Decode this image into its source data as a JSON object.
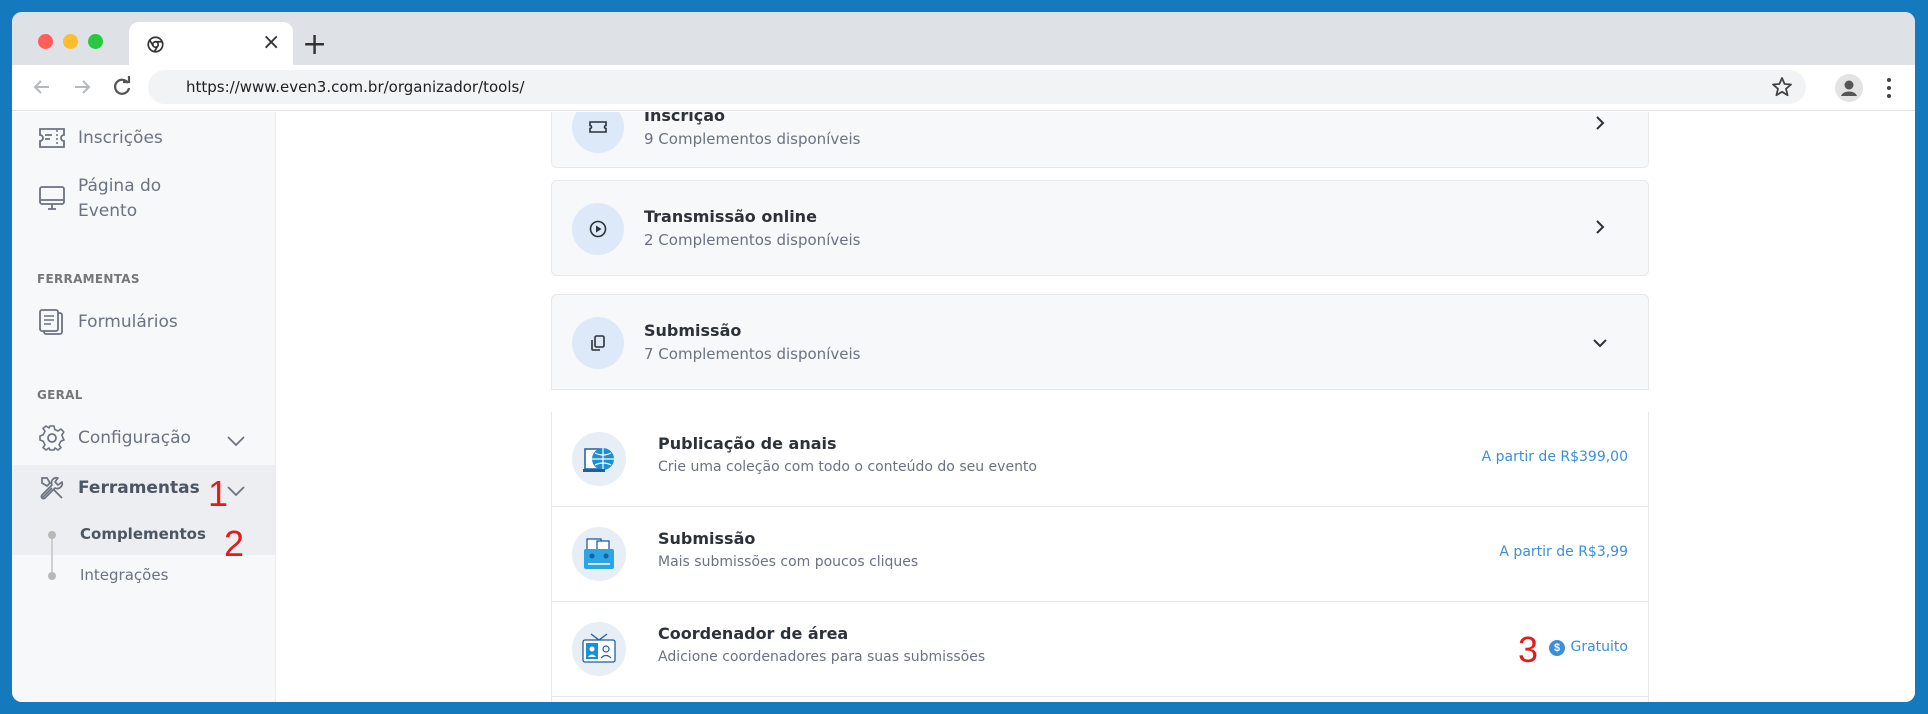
{
  "browser": {
    "url": "https://www.even3.com.br/organizador/tools/",
    "tab_close": "×",
    "new_tab": "+"
  },
  "sidebar": {
    "items": [
      {
        "label": "Inscrições",
        "icon": "ticket-icon"
      },
      {
        "label": "Página do Evento",
        "icon": "monitor-icon"
      }
    ],
    "section_tools": "FERRAMENTAS",
    "forms_label": "Formulários",
    "section_general": "GERAL",
    "config_label": "Configuração",
    "tools_label": "Ferramentas",
    "sub_items": [
      "Complementos",
      "Integrações"
    ]
  },
  "annotations": [
    "1",
    "2",
    "3"
  ],
  "categories": [
    {
      "title": "Inscrição",
      "subtitle": "9 Complementos disponíveis",
      "icon": "ticket-icon",
      "state": "collapsed"
    },
    {
      "title": "Transmissão online",
      "subtitle": "2 Complementos disponíveis",
      "icon": "play-icon",
      "state": "collapsed"
    },
    {
      "title": "Submissão",
      "subtitle": "7 Complementos disponíveis",
      "icon": "copy-icon",
      "state": "expanded"
    }
  ],
  "addons": [
    {
      "title": "Publicação de anais",
      "description": "Crie uma coleção com todo o conteúdo do seu evento",
      "price": "A partir de R$399,00"
    },
    {
      "title": "Submissão",
      "description": "Mais submissões com poucos cliques",
      "price": "A partir de R$3,99"
    },
    {
      "title": "Coordenador de área",
      "description": "Adicione coordenadores para suas submissões",
      "price": "Gratuito",
      "price_icon": "$"
    }
  ],
  "colors": {
    "accent": "#3b8fd9",
    "frame": "#1479bd",
    "annotation": "#e41b1b"
  }
}
